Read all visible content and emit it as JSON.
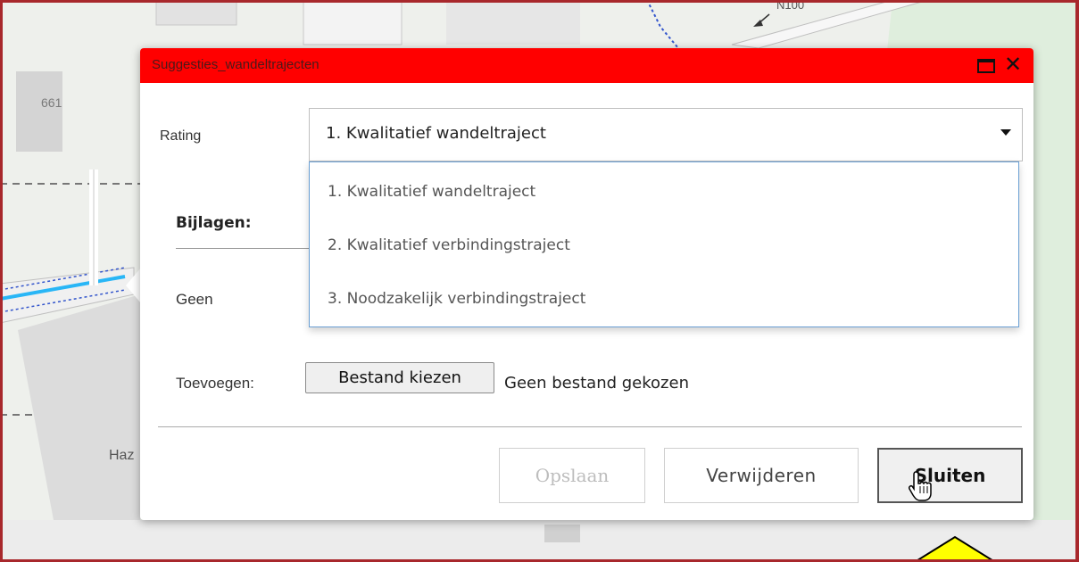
{
  "map": {
    "labels": [
      "661",
      "N100",
      "Haz"
    ]
  },
  "popup": {
    "title": "Suggesties_wandeltrajecten",
    "maximize_icon": "maximize-icon",
    "close_icon": "close-icon",
    "close_glyph": "✕",
    "title_color": "#ff0000"
  },
  "form": {
    "rating_label": "Rating",
    "rating_value": "1. Kwalitatief wandeltraject",
    "rating_options": [
      "1. Kwalitatief wandeltraject",
      "2. Kwalitatief verbindingstraject",
      "3. Noodzakelijk verbindingstraject"
    ],
    "attachments_label": "Bijlagen:",
    "attachments_value": "Geen",
    "add_label": "Toevoegen:",
    "file_button": "Bestand kiezen",
    "file_status": "Geen bestand gekozen"
  },
  "buttons": {
    "save": "Opslaan",
    "delete": "Verwijderen",
    "close": "Sluiten"
  }
}
